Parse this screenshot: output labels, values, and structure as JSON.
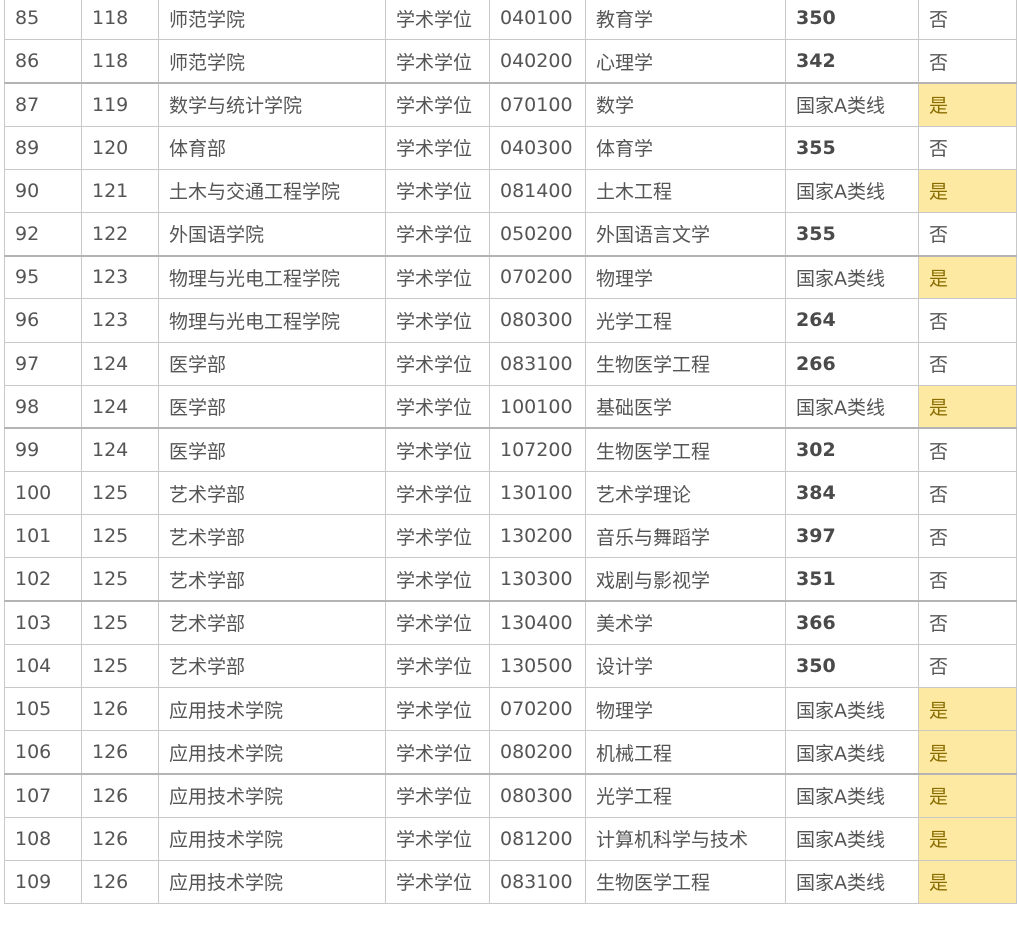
{
  "table": {
    "rows": [
      {
        "seq": "85",
        "code": "118",
        "college": "师范学院",
        "degree": "学术学位",
        "major_code": "040100",
        "major": "教育学",
        "score": "350",
        "score_bold": true,
        "flag": "否",
        "flag_highlight": false,
        "group_start": false
      },
      {
        "seq": "86",
        "code": "118",
        "college": "师范学院",
        "degree": "学术学位",
        "major_code": "040200",
        "major": "心理学",
        "score": "342",
        "score_bold": true,
        "flag": "否",
        "flag_highlight": false,
        "group_start": false
      },
      {
        "seq": "87",
        "code": "119",
        "college": "数学与统计学院",
        "degree": "学术学位",
        "major_code": "070100",
        "major": "数学",
        "score": "国家A类线",
        "score_bold": false,
        "flag": "是",
        "flag_highlight": true,
        "group_start": true
      },
      {
        "seq": "89",
        "code": "120",
        "college": "体育部",
        "degree": "学术学位",
        "major_code": "040300",
        "major": "体育学",
        "score": "355",
        "score_bold": true,
        "flag": "否",
        "flag_highlight": false,
        "group_start": false
      },
      {
        "seq": "90",
        "code": "121",
        "college": "土木与交通工程学院",
        "degree": "学术学位",
        "major_code": "081400",
        "major": "土木工程",
        "score": "国家A类线",
        "score_bold": false,
        "flag": "是",
        "flag_highlight": true,
        "group_start": false
      },
      {
        "seq": "92",
        "code": "122",
        "college": "外国语学院",
        "degree": "学术学位",
        "major_code": "050200",
        "major": "外国语言文学",
        "score": "355",
        "score_bold": true,
        "flag": "否",
        "flag_highlight": false,
        "group_start": false
      },
      {
        "seq": "95",
        "code": "123",
        "college": "物理与光电工程学院",
        "degree": "学术学位",
        "major_code": "070200",
        "major": "物理学",
        "score": "国家A类线",
        "score_bold": false,
        "flag": "是",
        "flag_highlight": true,
        "group_start": true
      },
      {
        "seq": "96",
        "code": "123",
        "college": "物理与光电工程学院",
        "degree": "学术学位",
        "major_code": "080300",
        "major": "光学工程",
        "score": "264",
        "score_bold": true,
        "flag": "否",
        "flag_highlight": false,
        "group_start": false
      },
      {
        "seq": "97",
        "code": "124",
        "college": "医学部",
        "degree": "学术学位",
        "major_code": "083100",
        "major": "生物医学工程",
        "score": "266",
        "score_bold": true,
        "flag": "否",
        "flag_highlight": false,
        "group_start": false
      },
      {
        "seq": "98",
        "code": "124",
        "college": "医学部",
        "degree": "学术学位",
        "major_code": "100100",
        "major": "基础医学",
        "score": "国家A类线",
        "score_bold": false,
        "flag": "是",
        "flag_highlight": true,
        "group_start": false
      },
      {
        "seq": "99",
        "code": "124",
        "college": "医学部",
        "degree": "学术学位",
        "major_code": "107200",
        "major": "生物医学工程",
        "score": "302",
        "score_bold": true,
        "flag": "否",
        "flag_highlight": false,
        "group_start": true
      },
      {
        "seq": "100",
        "code": "125",
        "college": "艺术学部",
        "degree": "学术学位",
        "major_code": "130100",
        "major": "艺术学理论",
        "score": "384",
        "score_bold": true,
        "flag": "否",
        "flag_highlight": false,
        "group_start": false
      },
      {
        "seq": "101",
        "code": "125",
        "college": "艺术学部",
        "degree": "学术学位",
        "major_code": "130200",
        "major": "音乐与舞蹈学",
        "score": "397",
        "score_bold": true,
        "flag": "否",
        "flag_highlight": false,
        "group_start": false
      },
      {
        "seq": "102",
        "code": "125",
        "college": "艺术学部",
        "degree": "学术学位",
        "major_code": "130300",
        "major": "戏剧与影视学",
        "score": "351",
        "score_bold": true,
        "flag": "否",
        "flag_highlight": false,
        "group_start": false
      },
      {
        "seq": "103",
        "code": "125",
        "college": "艺术学部",
        "degree": "学术学位",
        "major_code": "130400",
        "major": "美术学",
        "score": "366",
        "score_bold": true,
        "flag": "否",
        "flag_highlight": false,
        "group_start": true
      },
      {
        "seq": "104",
        "code": "125",
        "college": "艺术学部",
        "degree": "学术学位",
        "major_code": "130500",
        "major": "设计学",
        "score": "350",
        "score_bold": true,
        "flag": "否",
        "flag_highlight": false,
        "group_start": false
      },
      {
        "seq": "105",
        "code": "126",
        "college": "应用技术学院",
        "degree": "学术学位",
        "major_code": "070200",
        "major": "物理学",
        "score": "国家A类线",
        "score_bold": false,
        "flag": "是",
        "flag_highlight": true,
        "group_start": false
      },
      {
        "seq": "106",
        "code": "126",
        "college": "应用技术学院",
        "degree": "学术学位",
        "major_code": "080200",
        "major": "机械工程",
        "score": "国家A类线",
        "score_bold": false,
        "flag": "是",
        "flag_highlight": true,
        "group_start": false
      },
      {
        "seq": "107",
        "code": "126",
        "college": "应用技术学院",
        "degree": "学术学位",
        "major_code": "080300",
        "major": "光学工程",
        "score": "国家A类线",
        "score_bold": false,
        "flag": "是",
        "flag_highlight": true,
        "group_start": true
      },
      {
        "seq": "108",
        "code": "126",
        "college": "应用技术学院",
        "degree": "学术学位",
        "major_code": "081200",
        "major": "计算机科学与技术",
        "score": "国家A类线",
        "score_bold": false,
        "flag": "是",
        "flag_highlight": true,
        "group_start": false
      },
      {
        "seq": "109",
        "code": "126",
        "college": "应用技术学院",
        "degree": "学术学位",
        "major_code": "083100",
        "major": "生物医学工程",
        "score": "国家A类线",
        "score_bold": false,
        "flag": "是",
        "flag_highlight": true,
        "group_start": false
      }
    ]
  },
  "colors": {
    "highlight_bg": "#fde9a2",
    "highlight_text": "#8a6d00",
    "border": "#c8c8c8",
    "text": "#555555"
  }
}
